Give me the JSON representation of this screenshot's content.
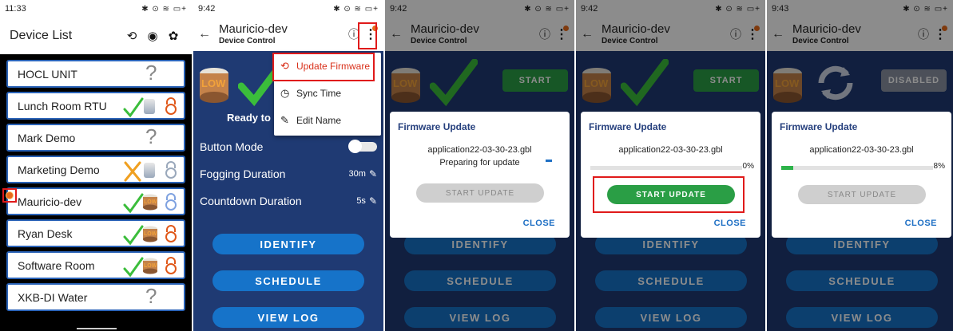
{
  "panel1": {
    "status_time": "11:33",
    "status_icons_right": "✱ ⊙ ≋ ▭+",
    "title": "Device List",
    "header_icons": [
      "refresh-icon",
      "target-icon",
      "gear-icon"
    ],
    "devices": [
      {
        "name": "HOCL UNIT",
        "status": "unknown"
      },
      {
        "name": "Lunch Room RTU",
        "status": "ok"
      },
      {
        "name": "Mark Demo",
        "status": "unknown"
      },
      {
        "name": "Marketing Demo",
        "status": "error"
      },
      {
        "name": "Mauricio-dev",
        "status": "ok-low"
      },
      {
        "name": "Ryan Desk",
        "status": "ok-low"
      },
      {
        "name": "Software Room",
        "status": "ok-low"
      },
      {
        "name": "XKB-DI Water",
        "status": "unknown"
      }
    ]
  },
  "device_control": {
    "title": "Mauricio-dev",
    "subtitle": "Device Control",
    "low_label": "LOW",
    "ready_text": "Ready to",
    "button_mode_label": "Button Mode",
    "fogging_label": "Fogging Duration",
    "fogging_value": "30m",
    "countdown_label": "Countdown Duration",
    "countdown_value": "5s",
    "identify_label": "IDENTIFY",
    "schedule_label": "SCHEDULE",
    "viewlog_label": "VIEW LOG",
    "start_label": "START",
    "disabled_label": "DISABLED"
  },
  "menu": {
    "items": [
      {
        "label": "Update Firmware",
        "icon": "refresh-icon"
      },
      {
        "label": "Sync Time",
        "icon": "clock-icon"
      },
      {
        "label": "Edit Name",
        "icon": "pencil-icon"
      }
    ]
  },
  "firmware": {
    "dialog_title": "Firmware Update",
    "filename": "application22-03-30-23.gbl",
    "preparing_text": "Preparing for update",
    "start_update_label": "START UPDATE",
    "close_label": "CLOSE",
    "pct_zero": "0%",
    "pct_eight": "8%",
    "progress_panel4": 0.0,
    "progress_panel5": 0.08
  },
  "status_times": {
    "p2": "9:42",
    "p3": "9:42",
    "p4": "9:42",
    "p5": "9:43"
  },
  "colors": {
    "accent_blue": "#1673c9",
    "dark_navy": "#1f3a73",
    "start_green": "#2a9e45",
    "highlight_red": "#e01a1a",
    "orange_dot": "#e86a1a"
  }
}
